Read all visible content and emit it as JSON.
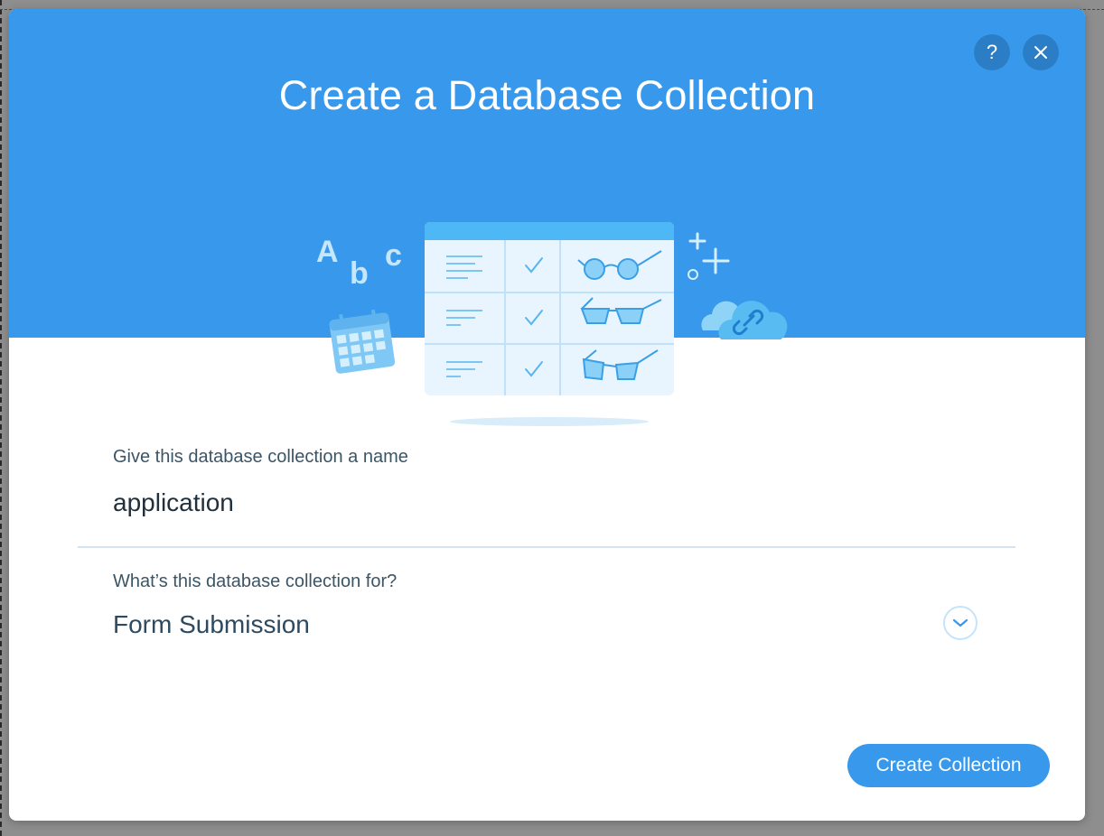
{
  "dialog": {
    "title": "Create a Database Collection",
    "help_symbol": "?",
    "icons": {
      "help": "question-icon",
      "close": "close-icon",
      "dropdown": "chevron-down-icon"
    },
    "illustration_letters": [
      "A",
      "b",
      "c"
    ]
  },
  "form": {
    "name_label": "Give this database collection a name",
    "name_value": "application",
    "purpose_label": "What’s this database collection for?",
    "purpose_value": "Form Submission"
  },
  "actions": {
    "create_label": "Create Collection"
  },
  "colors": {
    "header": "#3899ec",
    "button": "#3899ec",
    "label_text": "#3b5566",
    "value_text": "#2d4a60"
  }
}
